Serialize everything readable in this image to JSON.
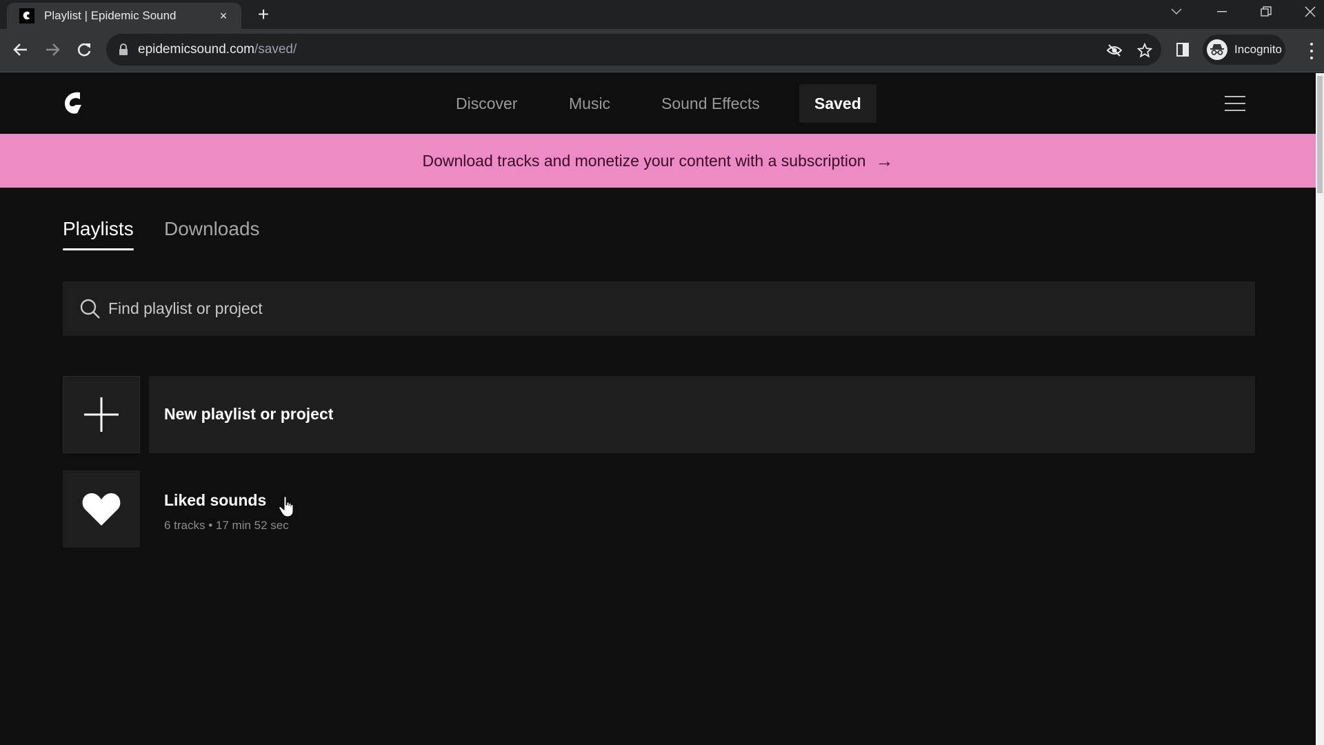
{
  "browser": {
    "tab": {
      "title": "Playlist | Epidemic Sound",
      "close_label": "×"
    },
    "new_tab_label": "+",
    "url": {
      "domain": "epidemicsound.com",
      "path": "/saved/"
    },
    "profile_label": "Incognito"
  },
  "site": {
    "nav": [
      {
        "label": "Discover",
        "active": false
      },
      {
        "label": "Music",
        "active": false
      },
      {
        "label": "Sound Effects",
        "active": false
      },
      {
        "label": "Saved",
        "active": true
      }
    ],
    "promo": {
      "text": "Download tracks and monetize your content with a subscription",
      "arrow": "→",
      "background": "#ec8bc6"
    }
  },
  "saved": {
    "tabs": [
      {
        "label": "Playlists",
        "active": true
      },
      {
        "label": "Downloads",
        "active": false
      }
    ],
    "search": {
      "placeholder": "Find playlist or project",
      "value": ""
    },
    "new_playlist": {
      "label": "New playlist or project"
    },
    "playlists": [
      {
        "name": "Liked sounds",
        "meta": "6 tracks • 17 min 52 sec",
        "icon": "heart-icon"
      }
    ]
  }
}
